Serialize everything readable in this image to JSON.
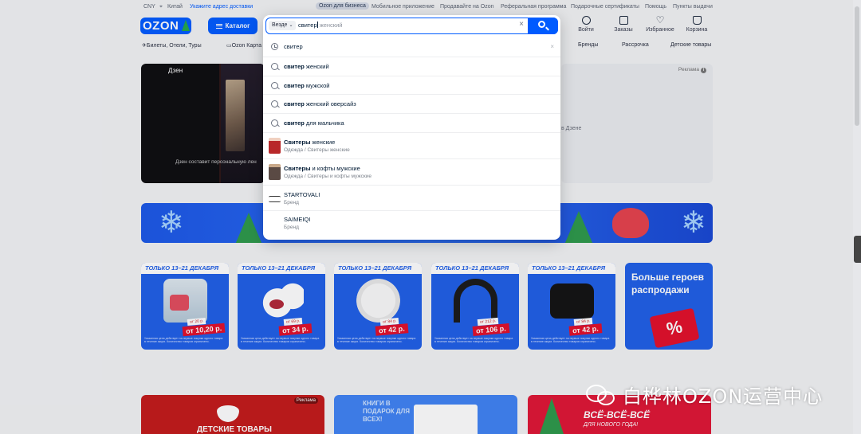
{
  "topbar": {
    "currency": "CNY",
    "location_country": "Китай",
    "location_link": "Укажите адрес доставки",
    "links": [
      "Ozon для бизнеса",
      "Мобильное приложение",
      "Продавайте на Ozon",
      "Реферальная программа",
      "Подарочные сертификаты",
      "Помощь",
      "Пункты выдачи"
    ]
  },
  "header": {
    "logo_text": "OZON",
    "catalog_label": "Каталог",
    "actions": [
      {
        "label": "Войти",
        "icon": "user-icon"
      },
      {
        "label": "Заказы",
        "icon": "box-icon"
      },
      {
        "label": "Избранное",
        "icon": "heart-icon"
      },
      {
        "label": "Корзина",
        "icon": "cart-icon"
      }
    ]
  },
  "nav": {
    "left": [
      "Билеты, Отели, Туры",
      "Ozon Карта"
    ],
    "right": [
      "Бренды",
      "Рассрочка",
      "Детские товары"
    ]
  },
  "search": {
    "scope": "Везде",
    "typed": "свитер",
    "completion": " женский"
  },
  "suggestions": [
    {
      "kind": "history",
      "bold": "",
      "rest": "свитер"
    },
    {
      "kind": "query",
      "bold": "свитер",
      "rest": " женский"
    },
    {
      "kind": "query",
      "bold": "свитер",
      "rest": " мужской"
    },
    {
      "kind": "query",
      "bold": "свитер",
      "rest": " женский оверсайз"
    },
    {
      "kind": "query",
      "bold": "свитер",
      "rest": " для мальчика"
    }
  ],
  "categories": [
    {
      "bold": "Свитеры",
      "rest": " женские",
      "sub_a": "Одежда",
      "sub_b": "Свитеры женские"
    },
    {
      "bold": "Свитеры",
      "rest": " и кофты мужские",
      "sub_a": "Одежда",
      "sub_b": "Свитеры и кофты мужские"
    }
  ],
  "brands": [
    {
      "name": "STARTOVALI",
      "sub": "Бренд"
    },
    {
      "name": "SAIMEIQI",
      "sub": "Бренд"
    }
  ],
  "zen": {
    "title": "Дзен",
    "subtitle": "Дзен составит персональную лен",
    "right_text": "в Дзене",
    "ad_label": "Реклама"
  },
  "promos": [
    {
      "header": "ТОЛЬКО 13–21 ДЕКАБРЯ",
      "was": "от 20 р.",
      "price": "от 10,20 р."
    },
    {
      "header": "ТОЛЬКО 13–21 ДЕКАБРЯ",
      "was": "от 69 р.",
      "price": "от 34 р."
    },
    {
      "header": "ТОЛЬКО 13–21 ДЕКАБРЯ",
      "was": "от 84 р.",
      "price": "от 42 р."
    },
    {
      "header": "ТОЛЬКО 13–21 ДЕКАБРЯ",
      "was": "от 212 р.",
      "price": "от 106 р."
    },
    {
      "header": "ТОЛЬКО 13–21 ДЕКАБРЯ",
      "was": "от 84 р.",
      "price": "от 42 р."
    }
  ],
  "promo_fine": "Указанная цена действует на первые покупки одного товара в течение акции. Количество товаров ограничено.",
  "promo_last": {
    "text": "Больше героев распродажи",
    "tag": "%"
  },
  "bottom": {
    "kids": "ДЕТСКИЕ ТОВАРЫ",
    "kids_ad": "Реклама",
    "books": "КНИГИ В ПОДАРОК ДЛЯ ВСЕХ!",
    "all_title": "ВСЁ-ВСЁ-ВСЁ",
    "all_sub": "ДЛЯ НОВОГО ГОДА!"
  },
  "watermark": "白桦林OZON运营中心"
}
